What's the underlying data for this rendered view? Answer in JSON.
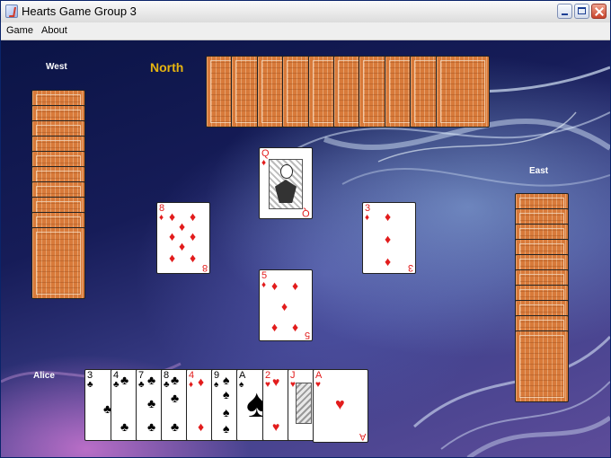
{
  "window": {
    "title": "Hearts Game Group 3"
  },
  "menu": [
    {
      "label": "Game"
    },
    {
      "label": "About"
    }
  ],
  "players": {
    "west": {
      "label": "West"
    },
    "north": {
      "label": "North"
    },
    "east": {
      "label": "East"
    },
    "south": {
      "label": "Alice"
    }
  },
  "trick": {
    "north": {
      "rank": "Q",
      "suit": "♦",
      "color": "red"
    },
    "west": {
      "rank": "8",
      "suit": "♦",
      "color": "red"
    },
    "east": {
      "rank": "3",
      "suit": "♦",
      "color": "red"
    },
    "south": {
      "rank": "5",
      "suit": "♦",
      "color": "red"
    }
  },
  "hand": [
    {
      "rank": "3",
      "suit": "♣",
      "color": "black"
    },
    {
      "rank": "4",
      "suit": "♣",
      "color": "black"
    },
    {
      "rank": "7",
      "suit": "♣",
      "color": "black"
    },
    {
      "rank": "8",
      "suit": "♣",
      "color": "black"
    },
    {
      "rank": "4",
      "suit": "♦",
      "color": "red"
    },
    {
      "rank": "9",
      "suit": "♠",
      "color": "black"
    },
    {
      "rank": "A",
      "suit": "♠",
      "color": "black"
    },
    {
      "rank": "2",
      "suit": "♥",
      "color": "red"
    },
    {
      "rank": "J",
      "suit": "♥",
      "color": "red"
    },
    {
      "rank": "A",
      "suit": "♥",
      "color": "red"
    }
  ],
  "hidden_counts": {
    "north": 10,
    "west": 10,
    "east": 10
  }
}
